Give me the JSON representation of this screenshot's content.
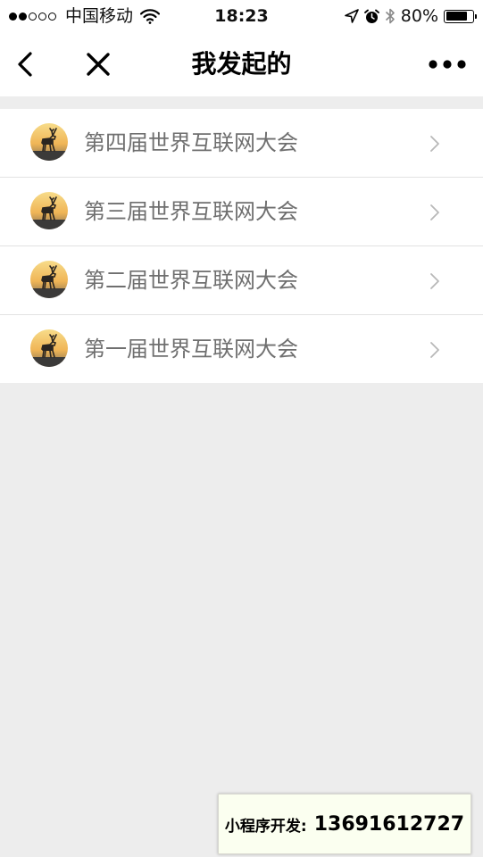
{
  "status_bar": {
    "carrier": "中国移动",
    "time": "18:23",
    "battery_percent": "80%",
    "battery_level": 0.8,
    "icons": [
      "signal-dots-icon",
      "wifi-icon",
      "location-icon",
      "alarm-icon",
      "bluetooth-icon",
      "battery-icon"
    ]
  },
  "nav": {
    "title": "我发起的",
    "icons": [
      "back-arrow-icon",
      "close-icon",
      "more-dots-icon"
    ]
  },
  "list": {
    "items": [
      {
        "label": "第四届世界互联网大会",
        "icon": "deer-sunset-avatar"
      },
      {
        "label": "第三届世界互联网大会",
        "icon": "deer-sunset-avatar"
      },
      {
        "label": "第二届世界互联网大会",
        "icon": "deer-sunset-avatar"
      },
      {
        "label": "第一届世界互联网大会",
        "icon": "deer-sunset-avatar"
      }
    ],
    "row_icon": "chevron-right-icon"
  },
  "promo": {
    "label": "小程序开发:",
    "phone": "13691612727"
  },
  "colors": {
    "background": "#ededed",
    "surface": "#ffffff",
    "list_text": "#6f6f6f",
    "divider": "#e2e2e2",
    "promo_bg": "#fbfff0"
  }
}
